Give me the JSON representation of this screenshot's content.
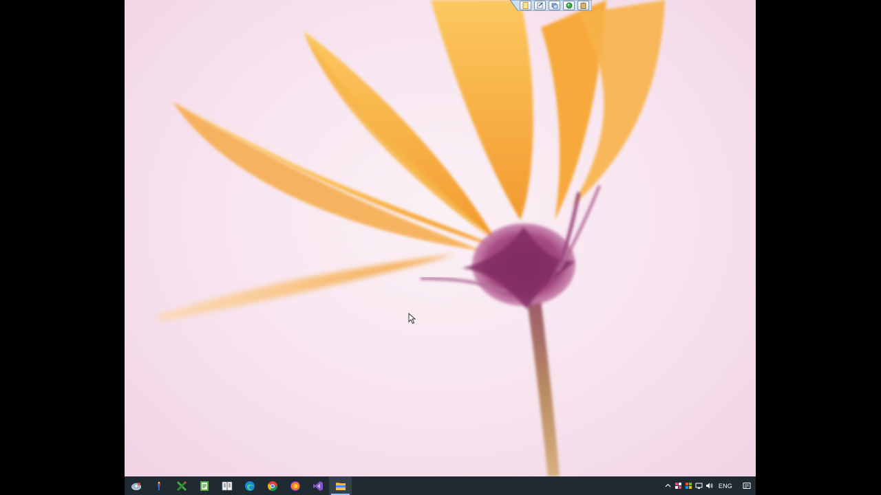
{
  "desktop": {
    "wallpaper": "orange-flower-wallpaper",
    "background_color": "#f7e3ee"
  },
  "mini_toolbar": {
    "buttons": [
      {
        "name": "new-doc-icon"
      },
      {
        "name": "edit-doc-icon"
      },
      {
        "name": "windows-icon"
      },
      {
        "name": "globe-icon"
      },
      {
        "name": "clipboard-icon"
      }
    ]
  },
  "taskbar": {
    "background_color": "#1f2a33",
    "apps": [
      {
        "name": "app-1",
        "icon": "disc-icon"
      },
      {
        "name": "app-2",
        "icon": "tool-icon"
      },
      {
        "name": "app-3",
        "icon": "x-tool-icon"
      },
      {
        "name": "app-4",
        "icon": "notepad-icon"
      },
      {
        "name": "app-5",
        "icon": "book-icon"
      },
      {
        "name": "app-6",
        "icon": "edge-icon"
      },
      {
        "name": "app-7",
        "icon": "chrome-icon"
      },
      {
        "name": "app-8",
        "icon": "firefox-icon"
      },
      {
        "name": "app-9",
        "icon": "visual-studio-icon"
      },
      {
        "name": "app-10",
        "icon": "file-explorer-icon",
        "active": true
      }
    ],
    "tray": {
      "language": "ENG"
    }
  }
}
